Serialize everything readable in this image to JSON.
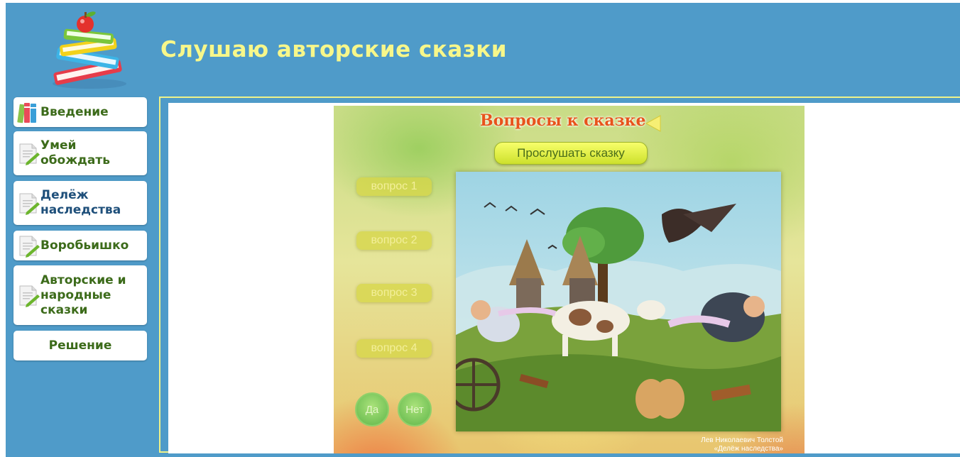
{
  "header": {
    "title": "Слушаю авторские сказки",
    "logo": "books-with-apple-icon"
  },
  "sidebar": {
    "items": [
      {
        "label": "Введение",
        "icon": "books-icon"
      },
      {
        "label": "Умей обождать",
        "icon": "document-pencil-icon"
      },
      {
        "label": "Делёж наследства",
        "icon": "document-pencil-icon",
        "active": true
      },
      {
        "label": "Воробьишко",
        "icon": "document-pencil-icon"
      },
      {
        "label": "Авторские и народные сказки",
        "icon": "document-pencil-icon"
      },
      {
        "label": "Решение",
        "icon": null
      }
    ]
  },
  "stage": {
    "title": "Вопросы к сказке",
    "listen_label": "Прослушать сказку",
    "questions": [
      "вопрос 1",
      "вопрос 2",
      "вопрос 3",
      "вопрос 4"
    ],
    "yes_label": "Да",
    "no_label": "Нет",
    "credit_author": "Лев Николаевич Толстой",
    "credit_title": "«Делёж наследства»"
  },
  "colors": {
    "background": "#4f9bc9",
    "title": "#f7f78a",
    "frame": "#eef28a",
    "nav_text": "#3c6b1a",
    "stage_title": "#e8531b"
  }
}
